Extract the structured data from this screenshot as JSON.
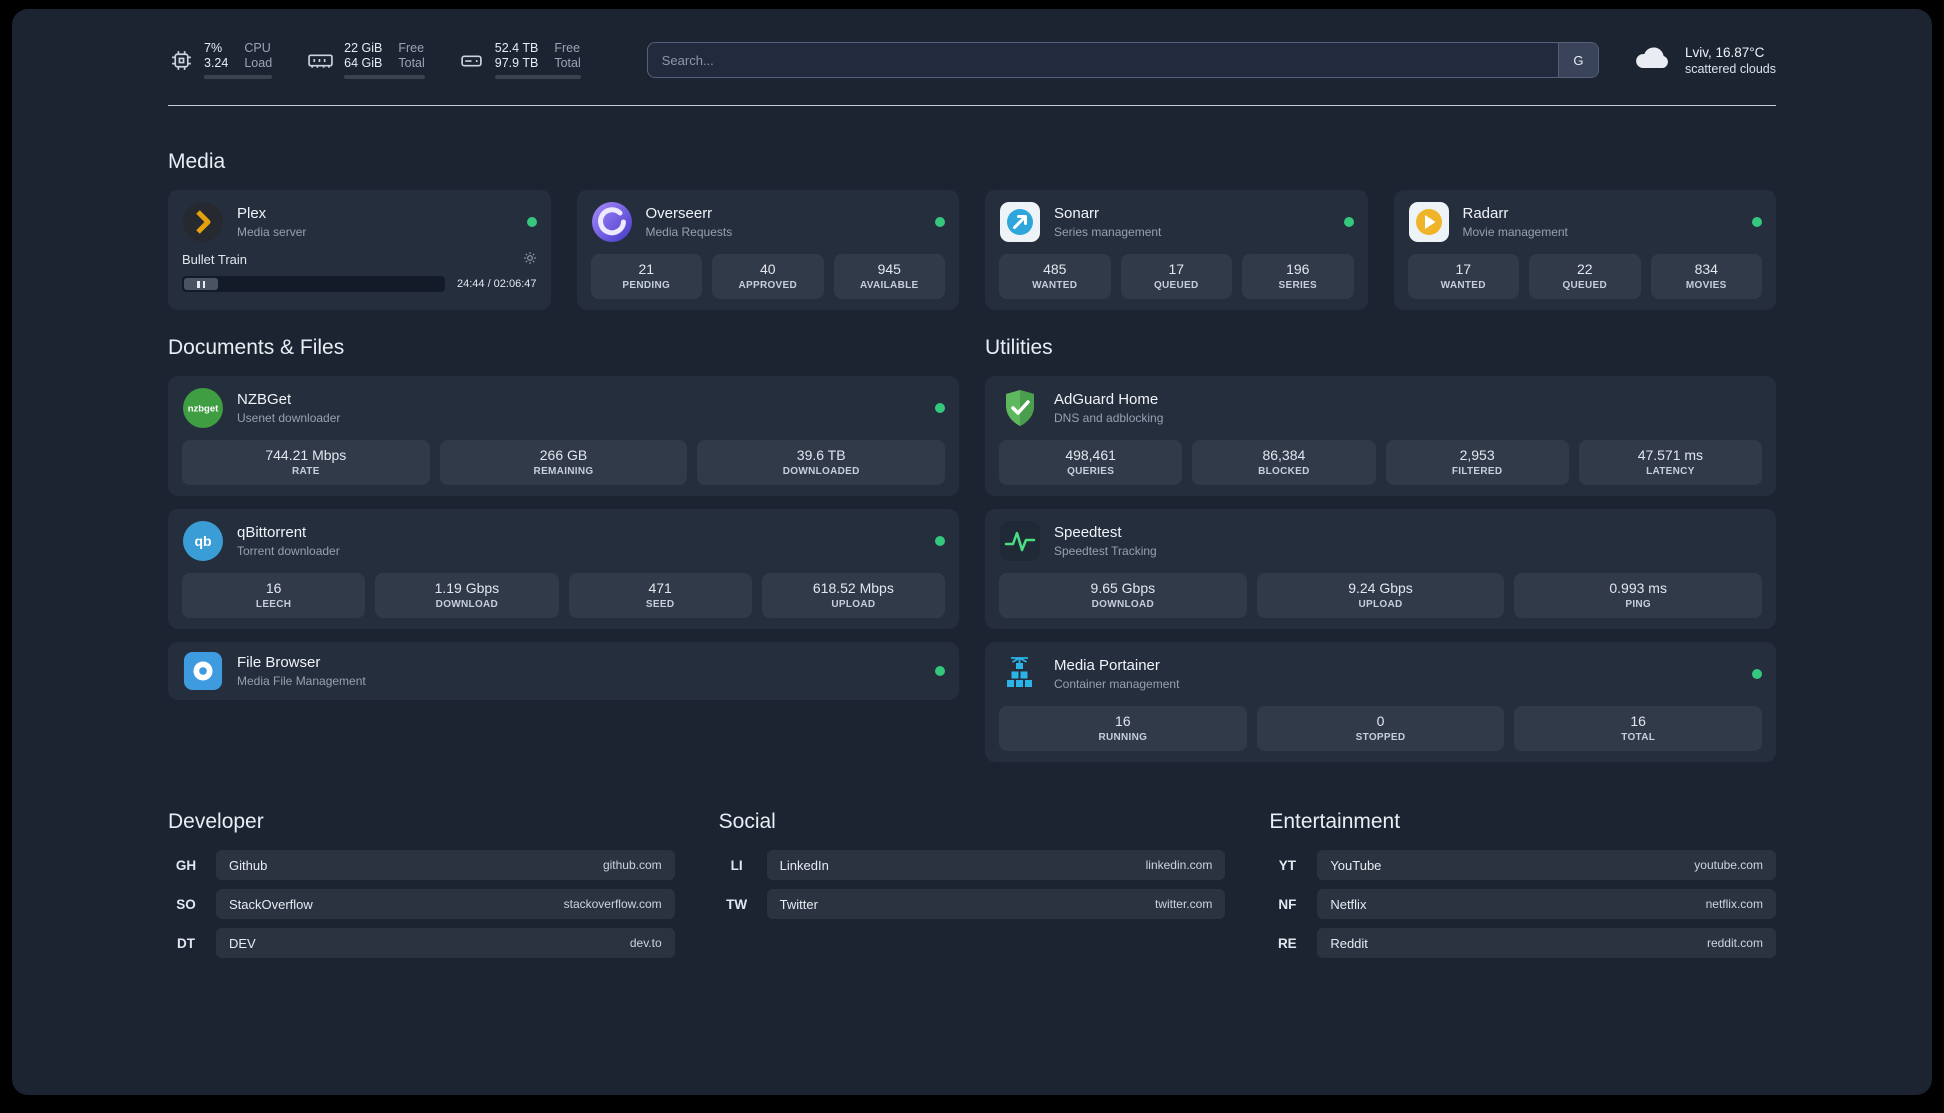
{
  "statusbar": {
    "cpu": {
      "value1": "7%",
      "value2": "3.24",
      "label1": "CPU",
      "label2": "Load",
      "percent": "7%"
    },
    "ram": {
      "value1": "22 GiB",
      "value2": "64 GiB",
      "label1": "Free",
      "label2": "Total",
      "percent": "66%"
    },
    "disk": {
      "value1": "52.4 TB",
      "value2": "97.9 TB",
      "label1": "Free",
      "label2": "Total",
      "percent": "46%"
    },
    "search": {
      "placeholder": "Search...",
      "button_label": "G"
    },
    "weather": {
      "location": "Lviv, 16.87°C",
      "condition": "scattered clouds"
    }
  },
  "sections": {
    "media": {
      "title": "Media",
      "plex": {
        "name": "Plex",
        "subtitle": "Media server",
        "player": {
          "title": "Bullet Train",
          "time": "24:44 / 02:06:47"
        }
      },
      "overseerr": {
        "name": "Overseerr",
        "subtitle": "Media Requests",
        "stats": [
          {
            "value": "21",
            "label": "PENDING"
          },
          {
            "value": "40",
            "label": "APPROVED"
          },
          {
            "value": "945",
            "label": "AVAILABLE"
          }
        ]
      },
      "sonarr": {
        "name": "Sonarr",
        "subtitle": "Series management",
        "stats": [
          {
            "value": "485",
            "label": "WANTED"
          },
          {
            "value": "17",
            "label": "QUEUED"
          },
          {
            "value": "196",
            "label": "SERIES"
          }
        ]
      },
      "radarr": {
        "name": "Radarr",
        "subtitle": "Movie management",
        "stats": [
          {
            "value": "17",
            "label": "WANTED"
          },
          {
            "value": "22",
            "label": "QUEUED"
          },
          {
            "value": "834",
            "label": "MOVIES"
          }
        ]
      }
    },
    "documents": {
      "title": "Documents & Files",
      "nzbget": {
        "name": "NZBGet",
        "subtitle": "Usenet downloader",
        "stats": [
          {
            "value": "744.21 Mbps",
            "label": "RATE"
          },
          {
            "value": "266 GB",
            "label": "REMAINING"
          },
          {
            "value": "39.6 TB",
            "label": "DOWNLOADED"
          }
        ]
      },
      "qbittorrent": {
        "name": "qBittorrent",
        "subtitle": "Torrent downloader",
        "stats": [
          {
            "value": "16",
            "label": "LEECH"
          },
          {
            "value": "1.19 Gbps",
            "label": "DOWNLOAD"
          },
          {
            "value": "471",
            "label": "SEED"
          },
          {
            "value": "618.52 Mbps",
            "label": "UPLOAD"
          }
        ]
      },
      "filebrowser": {
        "name": "File Browser",
        "subtitle": "Media File Management"
      }
    },
    "utilities": {
      "title": "Utilities",
      "adguard": {
        "name": "AdGuard Home",
        "subtitle": "DNS and adblocking",
        "stats": [
          {
            "value": "498,461",
            "label": "QUERIES"
          },
          {
            "value": "86,384",
            "label": "BLOCKED"
          },
          {
            "value": "2,953",
            "label": "FILTERED"
          },
          {
            "value": "47.571 ms",
            "label": "LATENCY"
          }
        ]
      },
      "speedtest": {
        "name": "Speedtest",
        "subtitle": "Speedtest Tracking",
        "stats": [
          {
            "value": "9.65 Gbps",
            "label": "DOWNLOAD"
          },
          {
            "value": "9.24 Gbps",
            "label": "UPLOAD"
          },
          {
            "value": "0.993 ms",
            "label": "PING"
          }
        ]
      },
      "portainer": {
        "name": "Media Portainer",
        "subtitle": "Container management",
        "stats": [
          {
            "value": "16",
            "label": "RUNNING"
          },
          {
            "value": "0",
            "label": "STOPPED"
          },
          {
            "value": "16",
            "label": "TOTAL"
          }
        ]
      }
    }
  },
  "bookmarks": {
    "developer": {
      "title": "Developer",
      "links": [
        {
          "abbr": "GH",
          "name": "Github",
          "url": "github.com"
        },
        {
          "abbr": "SO",
          "name": "StackOverflow",
          "url": "stackoverflow.com"
        },
        {
          "abbr": "DT",
          "name": "DEV",
          "url": "dev.to"
        }
      ]
    },
    "social": {
      "title": "Social",
      "links": [
        {
          "abbr": "LI",
          "name": "LinkedIn",
          "url": "linkedin.com"
        },
        {
          "abbr": "TW",
          "name": "Twitter",
          "url": "twitter.com"
        }
      ]
    },
    "entertainment": {
      "title": "Entertainment",
      "links": [
        {
          "abbr": "YT",
          "name": "YouTube",
          "url": "youtube.com"
        },
        {
          "abbr": "NF",
          "name": "Netflix",
          "url": "netflix.com"
        },
        {
          "abbr": "RE",
          "name": "Reddit",
          "url": "reddit.com"
        }
      ]
    }
  }
}
